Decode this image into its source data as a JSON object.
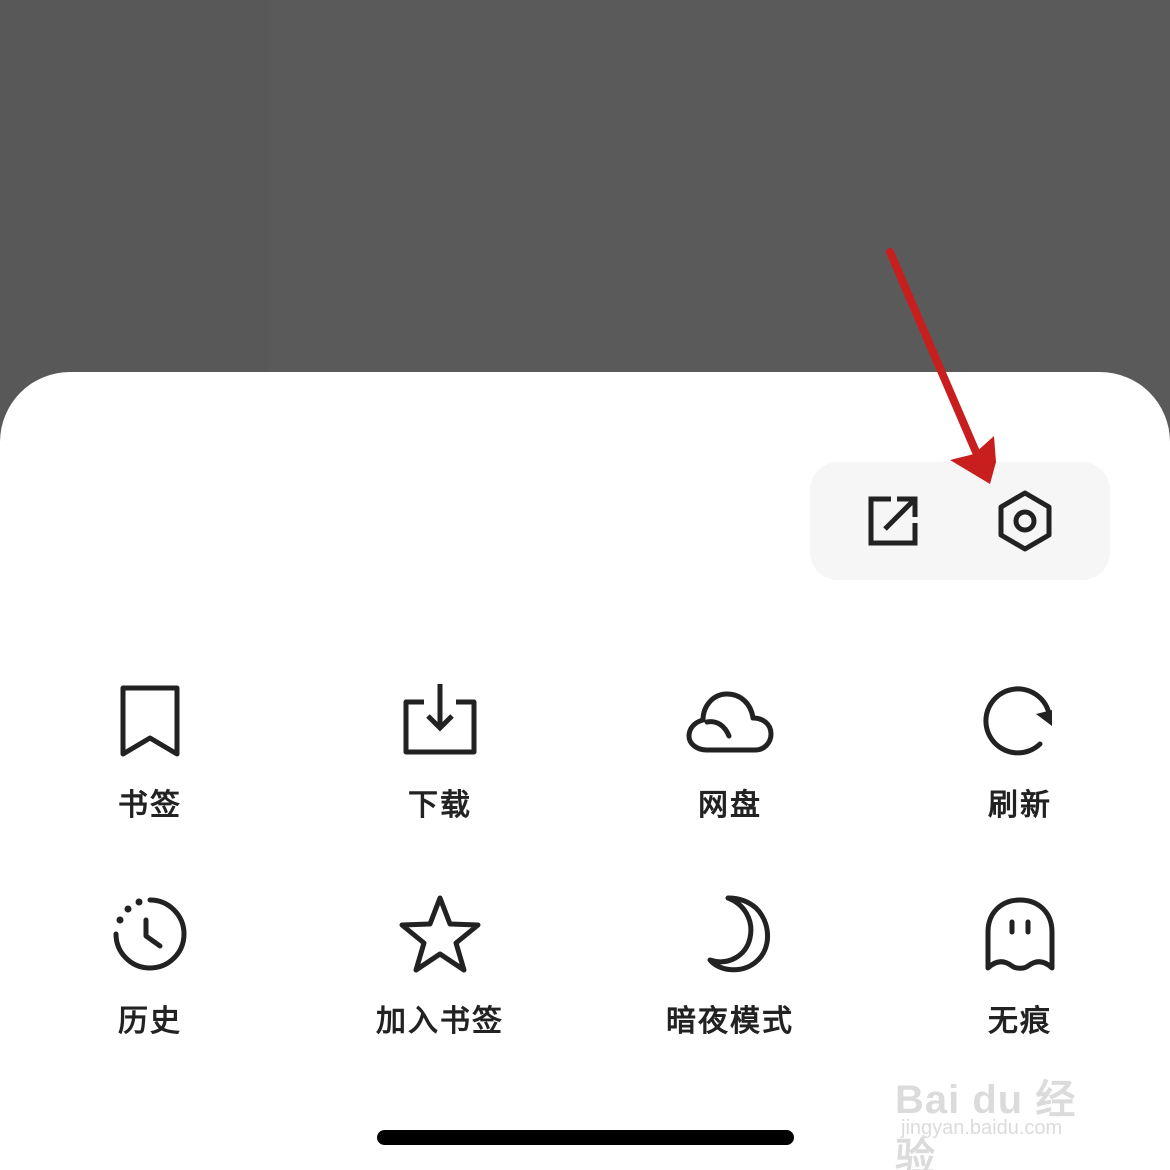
{
  "menu": {
    "row1": [
      {
        "label": "书签",
        "icon": "bookmark-icon"
      },
      {
        "label": "下载",
        "icon": "download-icon"
      },
      {
        "label": "网盘",
        "icon": "cloud-icon"
      },
      {
        "label": "刷新",
        "icon": "refresh-icon"
      }
    ],
    "row2": [
      {
        "label": "历史",
        "icon": "history-icon"
      },
      {
        "label": "加入书签",
        "icon": "star-icon"
      },
      {
        "label": "暗夜模式",
        "icon": "moon-icon"
      },
      {
        "label": "无痕",
        "icon": "ghost-icon"
      }
    ]
  },
  "quick_actions": [
    {
      "icon": "share-icon"
    },
    {
      "icon": "settings-icon"
    }
  ],
  "annotation": {
    "color": "#c81e1e"
  },
  "watermark": {
    "main": "Bai du 经验",
    "sub": "jingyan.baidu.com"
  },
  "colors": {
    "backdrop": "#5a5a5a",
    "sheet": "#ffffff",
    "icon_stroke": "#222222"
  }
}
